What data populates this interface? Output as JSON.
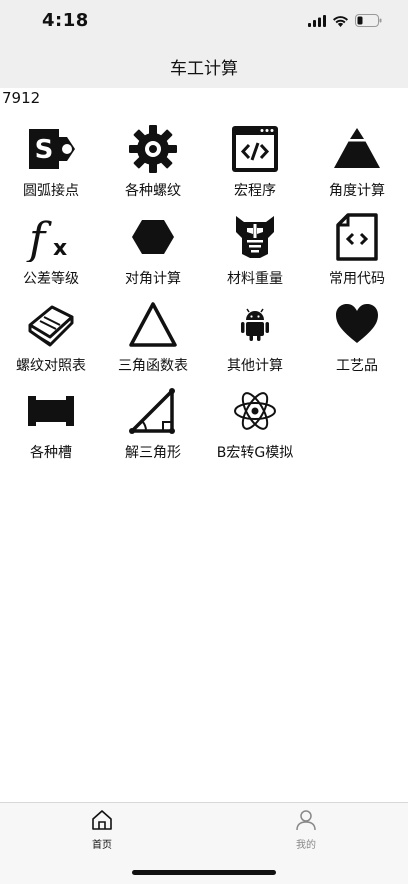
{
  "status_bar": {
    "time": "4:18"
  },
  "nav": {
    "title": "车工计算"
  },
  "counter": "7912",
  "menu": [
    {
      "label": "圆弧接点",
      "icon": "sharepoint-s-icon"
    },
    {
      "label": "各种螺纹",
      "icon": "gear-icon"
    },
    {
      "label": "宏程序",
      "icon": "code-window-icon"
    },
    {
      "label": "角度计算",
      "icon": "pyramid-icon"
    },
    {
      "label": "公差等级",
      "icon": "function-fx-icon"
    },
    {
      "label": "对角计算",
      "icon": "hexagon-icon"
    },
    {
      "label": "材料重量",
      "icon": "transformer-icon"
    },
    {
      "label": "常用代码",
      "icon": "code-file-icon"
    },
    {
      "label": "螺纹对照表",
      "icon": "book-icon"
    },
    {
      "label": "三角函数表",
      "icon": "triangle-icon"
    },
    {
      "label": "其他计算",
      "icon": "android-icon"
    },
    {
      "label": "工艺品",
      "icon": "heart-icon"
    },
    {
      "label": "各种槽",
      "icon": "slot-block-icon"
    },
    {
      "label": "解三角形",
      "icon": "right-triangle-icon"
    },
    {
      "label": "B宏转G模拟",
      "icon": "atom-icon"
    }
  ],
  "tabs": [
    {
      "label": "首页",
      "icon": "home-icon",
      "active": true
    },
    {
      "label": "我的",
      "icon": "user-icon",
      "active": false
    }
  ]
}
